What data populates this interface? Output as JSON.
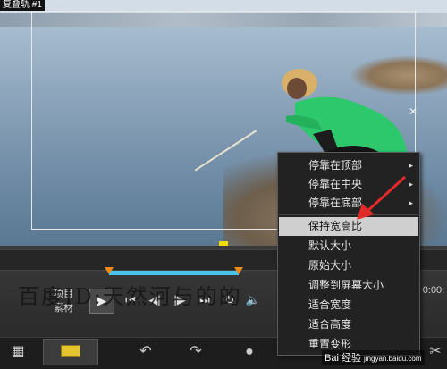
{
  "window": {
    "title_fragment": "复叠轨 #1"
  },
  "context_menu": {
    "items": [
      {
        "label": "停靠在顶部",
        "has_submenu": true,
        "selected": false
      },
      {
        "label": "停靠在中央",
        "has_submenu": true,
        "selected": false
      },
      {
        "label": "停靠在底部",
        "has_submenu": true,
        "selected": false
      },
      {
        "label": "保持宽高比",
        "has_submenu": false,
        "selected": true
      },
      {
        "label": "默认大小",
        "has_submenu": false,
        "selected": false
      },
      {
        "label": "原始大小",
        "has_submenu": false,
        "selected": false
      },
      {
        "label": "调整到屏幕大小",
        "has_submenu": false,
        "selected": false
      },
      {
        "label": "适合宽度",
        "has_submenu": false,
        "selected": false
      },
      {
        "label": "适合高度",
        "has_submenu": false,
        "selected": false
      },
      {
        "label": "重置变形",
        "has_submenu": false,
        "selected": false
      }
    ],
    "submenu_glyph": "▸"
  },
  "player": {
    "row_project": "项目",
    "row_clip": "素材",
    "time_fragment": "0:00:"
  },
  "watermark": {
    "text": "百度ID:天然河与的的"
  },
  "badge": {
    "text": "Bai 经验",
    "url": "jingyan.baidu.com"
  },
  "colors": {
    "accent_blue": "#49c3ea",
    "trim_orange": "#f08a1a",
    "handle_yellow": "#f2dc00",
    "menu_bg": "#222222",
    "menu_selected": "#cfcfcf",
    "arrow_red": "#e12a2a"
  },
  "icons": {
    "play": "play-icon",
    "prev": "skip-back-icon",
    "step_back": "step-back-icon",
    "step_forward": "step-forward-icon",
    "next": "skip-forward-icon",
    "loop": "repeat-icon",
    "volume": "volume-icon",
    "scissors": "scissors-icon",
    "undo": "undo-icon",
    "redo": "redo-icon",
    "record": "record-icon",
    "timeline": "timeline-view-icon",
    "storyboard": "storyboard-icon"
  }
}
